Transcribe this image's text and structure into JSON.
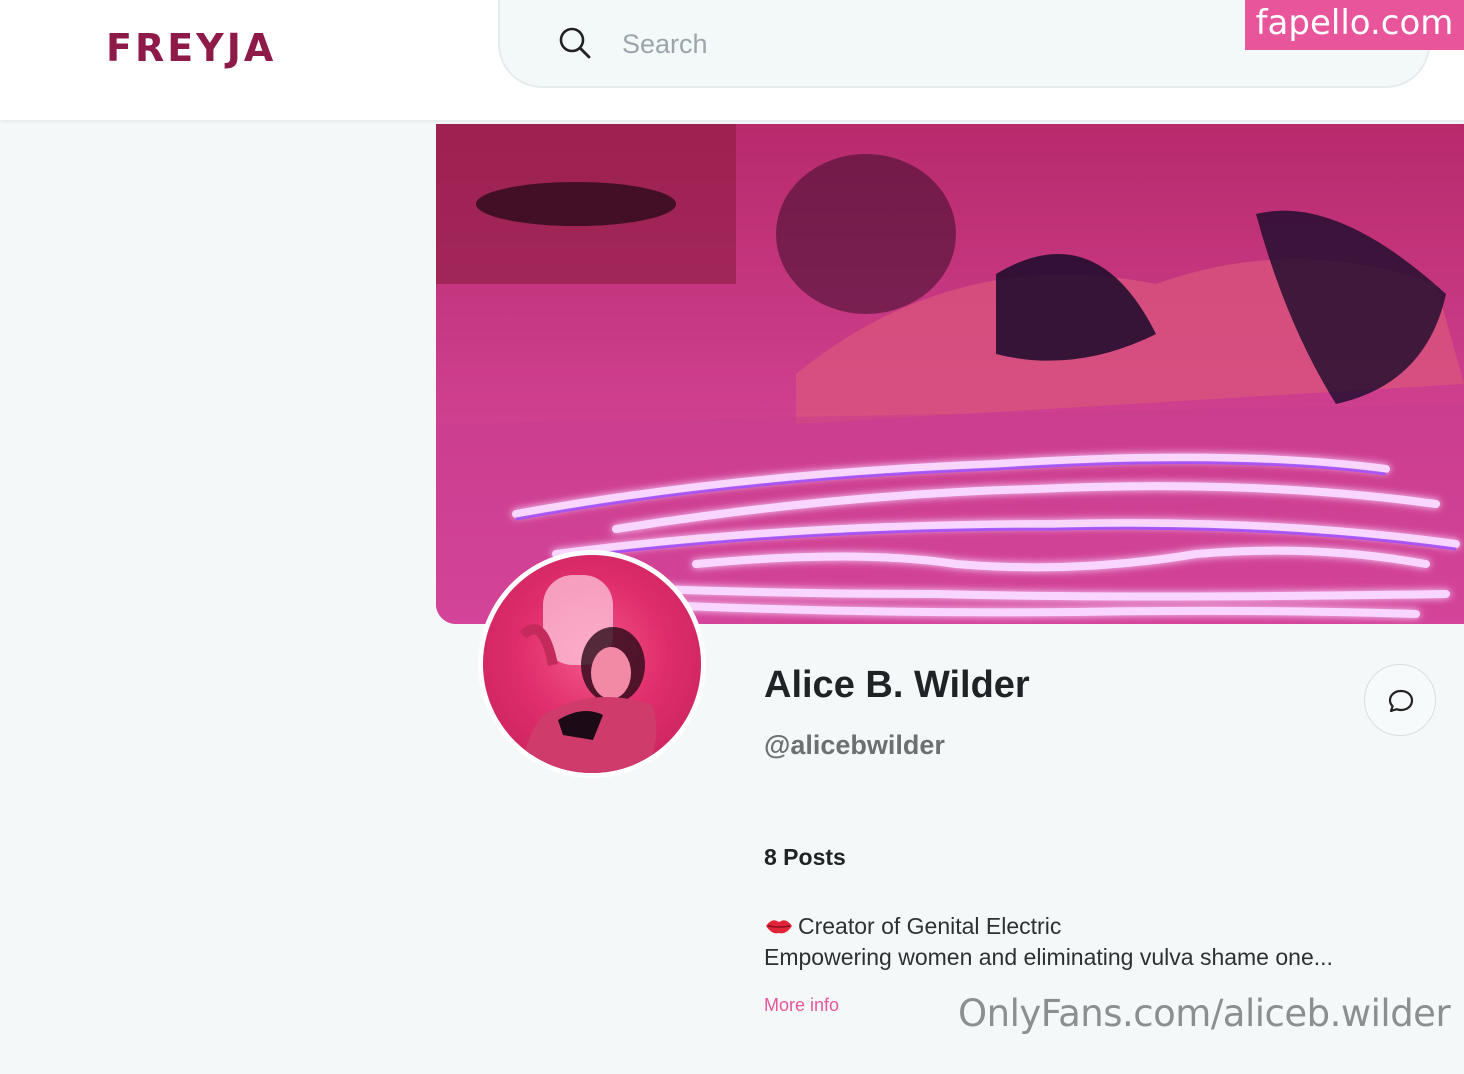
{
  "header": {
    "logo": "FREYJA",
    "search": {
      "placeholder": "Search",
      "value": ""
    }
  },
  "watermarks": {
    "top": "fapello.com",
    "bottom": "OnlyFans.com/aliceb.wilder"
  },
  "profile": {
    "display_name": "Alice B. Wilder",
    "handle": "@alicebwilder",
    "posts": "8 Posts",
    "bio_line1": "Creator of Genital Electric",
    "bio_line2": "Empowering women and eliminating vulva shame one...",
    "more_info": "More info"
  },
  "icons": {
    "search": "search-icon",
    "chat": "chat-bubble-icon",
    "bio_emoji": "kiss-lips-icon"
  },
  "colors": {
    "brand": "#8e1a4a",
    "accent_pink": "#e8559b",
    "background": "#f4f8f8"
  }
}
